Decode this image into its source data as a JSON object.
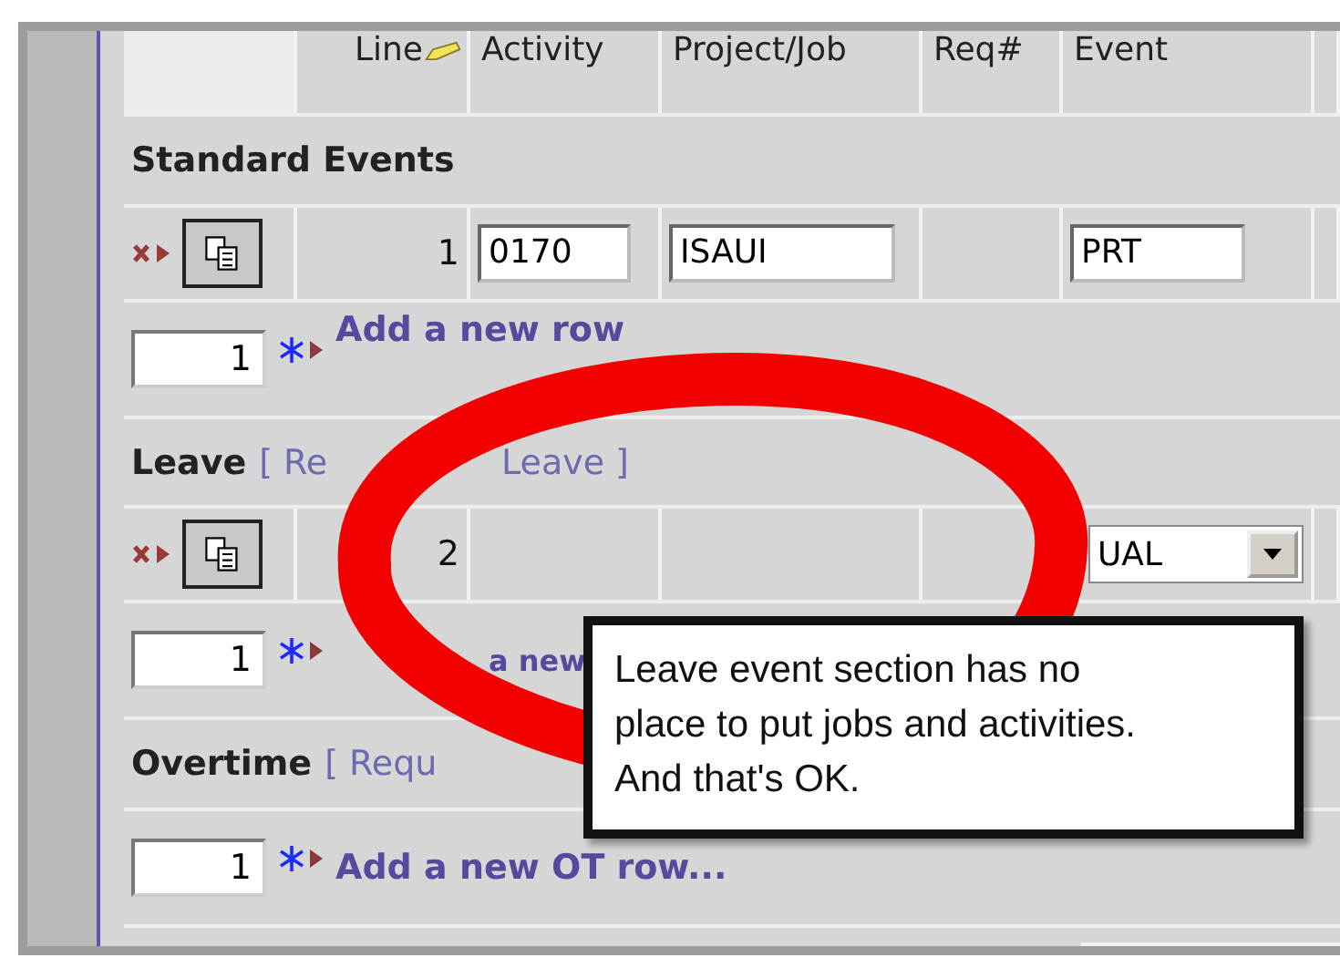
{
  "columns": [
    {
      "label": "Line"
    },
    {
      "label": "Activity"
    },
    {
      "label": "Project/Job"
    },
    {
      "label": "Req#"
    },
    {
      "label": "Event"
    }
  ],
  "sections": [
    {
      "title": "Standard Events",
      "rows": [
        {
          "line": "1",
          "activity": "0170",
          "project": "ISAUI",
          "event": "PRT",
          "kind": "text"
        }
      ],
      "add_count": "1",
      "add_label": "Add a new row"
    },
    {
      "title": "Leave",
      "link_parts": [
        "[ Re",
        "Leave ]"
      ],
      "rows": [
        {
          "line": "2",
          "event": "UAL",
          "kind": "select"
        }
      ],
      "add_count": "1",
      "add_label": "a new"
    },
    {
      "title": "Overtime",
      "link_parts": [
        "[ Requ"
      ],
      "add_count": "1",
      "add_label": "Add a new OT row..."
    }
  ],
  "callout_lines": [
    "Leave event section has no",
    "place to put jobs and activities.",
    "And that's OK."
  ]
}
